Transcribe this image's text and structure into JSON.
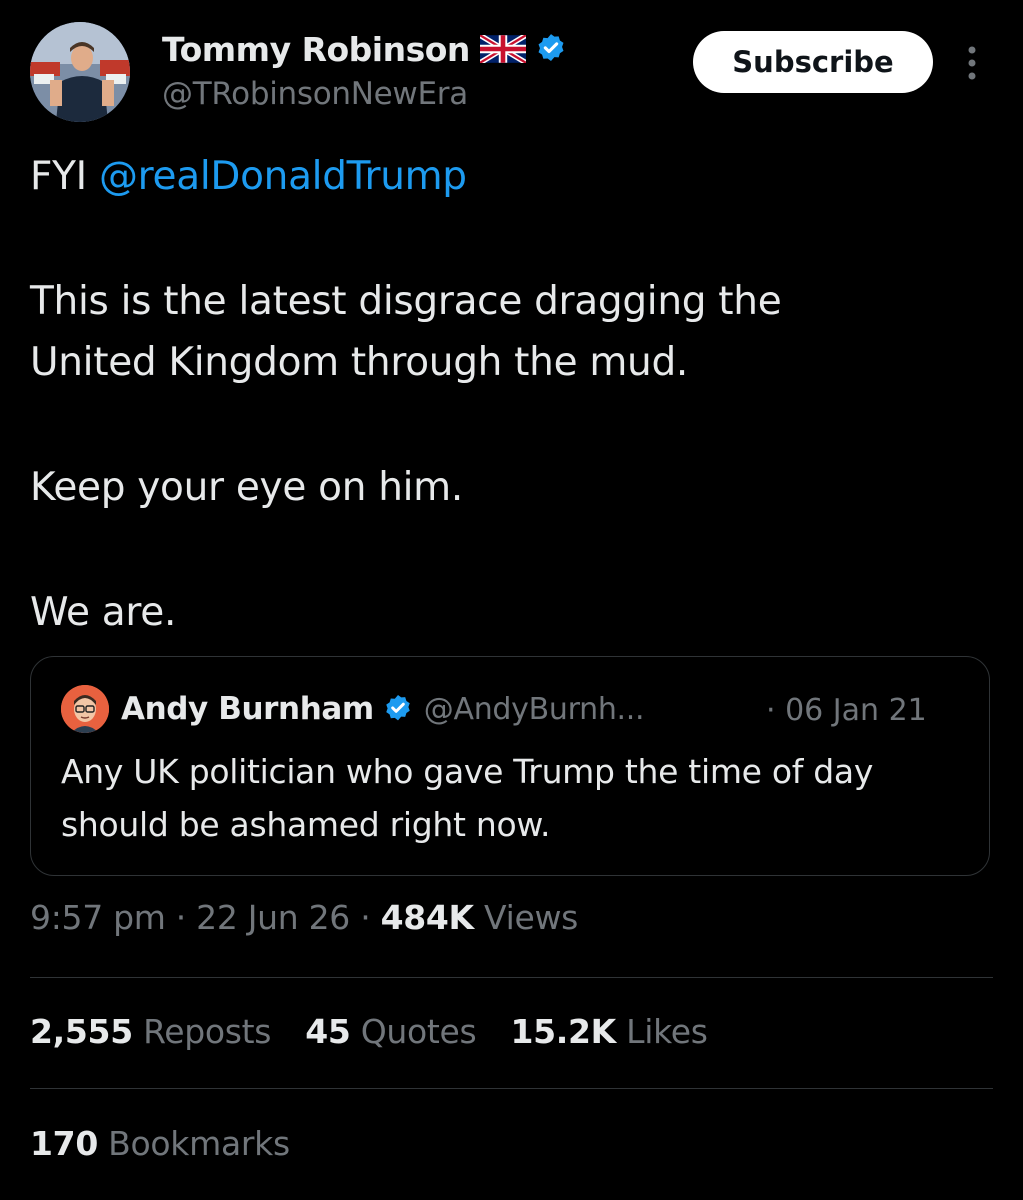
{
  "colors": {
    "background": "#000000",
    "text_primary": "#e7e9ea",
    "text_secondary": "#71767b",
    "link_blue": "#1d9bf0",
    "verified_blue": "#1d9bf0",
    "divider": "#2f3336",
    "subscribe_bg": "#ffffff"
  },
  "author": {
    "name": "Tommy Robinson",
    "flag_icon": "uk-flag-icon",
    "verified_icon": "verified-badge-icon",
    "handle": "@TRobinsonNewEra",
    "avatar_icon": "profile-photo"
  },
  "header": {
    "subscribe_label": "Subscribe",
    "more_icon": "vertical-ellipsis-icon"
  },
  "tweet": {
    "line1_prefix": "FYI ",
    "line1_mention": "@realDonaldTrump",
    "paragraph2": "This is the latest disgrace dragging the United Kingdom through the mud.",
    "paragraph3": "Keep your eye on him.",
    "paragraph4": "We are."
  },
  "quoted": {
    "name": "Andy Burnham",
    "handle": "@AndyBurnh...",
    "date": "· 06 Jan 21",
    "text": "Any UK politician who gave Trump the time of day should be ashamed right now.",
    "avatar_icon": "cartoon-avatar-icon",
    "verified_icon": "verified-badge-icon"
  },
  "meta": {
    "time": "9:57 pm",
    "sep1": " · ",
    "date": "22 Jun 26",
    "sep2": " · ",
    "views_count": "484K",
    "views_label": " Views"
  },
  "stats": {
    "reposts_count": "2,555",
    "reposts_label": " Reposts",
    "quotes_count": "45",
    "quotes_label": " Quotes",
    "likes_count": "15.2K",
    "likes_label": " Likes",
    "bookmarks_count": "170",
    "bookmarks_label": " Bookmarks"
  }
}
